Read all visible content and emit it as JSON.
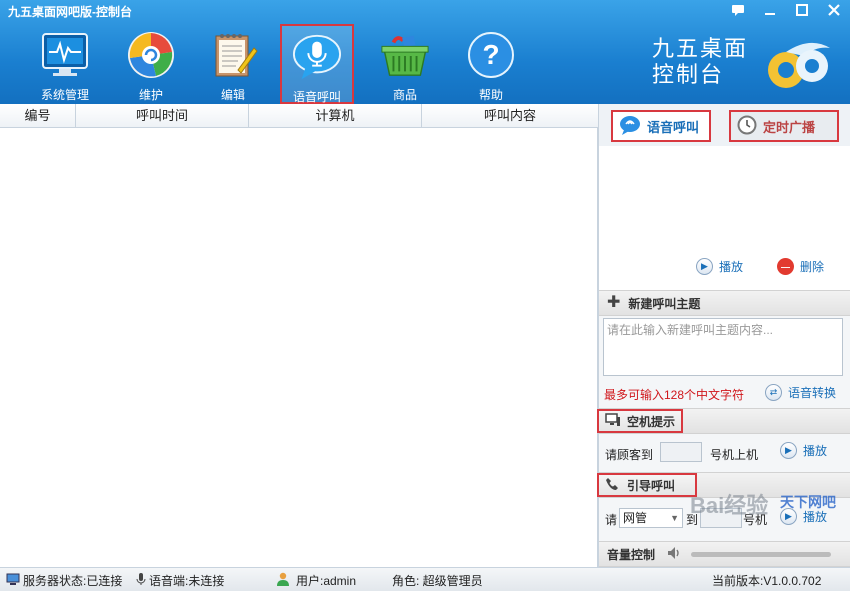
{
  "window": {
    "title": "九五桌面网吧版-控制台",
    "buttons": [
      "feedback",
      "minimize",
      "maximize",
      "close"
    ]
  },
  "toolbar": {
    "items": [
      {
        "label": "系统管理",
        "icon": "system-monitor-icon"
      },
      {
        "label": "维护",
        "icon": "maintenance-icon"
      },
      {
        "label": "编辑",
        "icon": "edit-notepad-icon"
      },
      {
        "label": "语音呼叫",
        "icon": "microphone-bubble-icon",
        "active": true
      },
      {
        "label": "商品",
        "icon": "shopping-basket-icon"
      },
      {
        "label": "帮助",
        "icon": "help-icon"
      }
    ],
    "brand_line1": "九五桌面",
    "brand_line2": "控制台"
  },
  "table": {
    "columns": [
      "编号",
      "呼叫时间",
      "计算机",
      "呼叫内容"
    ],
    "rows": []
  },
  "panel": {
    "tabs": [
      {
        "label": "语音呼叫",
        "icon": "voice-bubble-icon",
        "active": true
      },
      {
        "label": "定时广播",
        "icon": "clock-icon",
        "active": false
      }
    ],
    "play_label": "播放",
    "delete_label": "删除",
    "new_topic": {
      "title": "新建呼叫主题",
      "placeholder": "请在此输入新建呼叫主题内容...",
      "limit_hint": "最多可输入128个中文字符",
      "convert_label": "语音转换"
    },
    "idle_prompt": {
      "title": "空机提示",
      "text_before": "请顾客到",
      "text_after": "号机上机",
      "play_label": "播放"
    },
    "guide_call": {
      "title": "引导呼叫",
      "text_before": "请",
      "select_value": "网管",
      "text_mid": "到",
      "text_after": "号机",
      "play_label": "播放"
    },
    "volume_label": "音量控制"
  },
  "status": {
    "server": "服务器状态:已连接",
    "voice": "语音端:未连接",
    "user": "用户:admin",
    "role": "角色: 超级管理员",
    "version": "当前版本:V1.0.0.702"
  },
  "watermark": "Bai经验",
  "watermark2": "天下网吧"
}
